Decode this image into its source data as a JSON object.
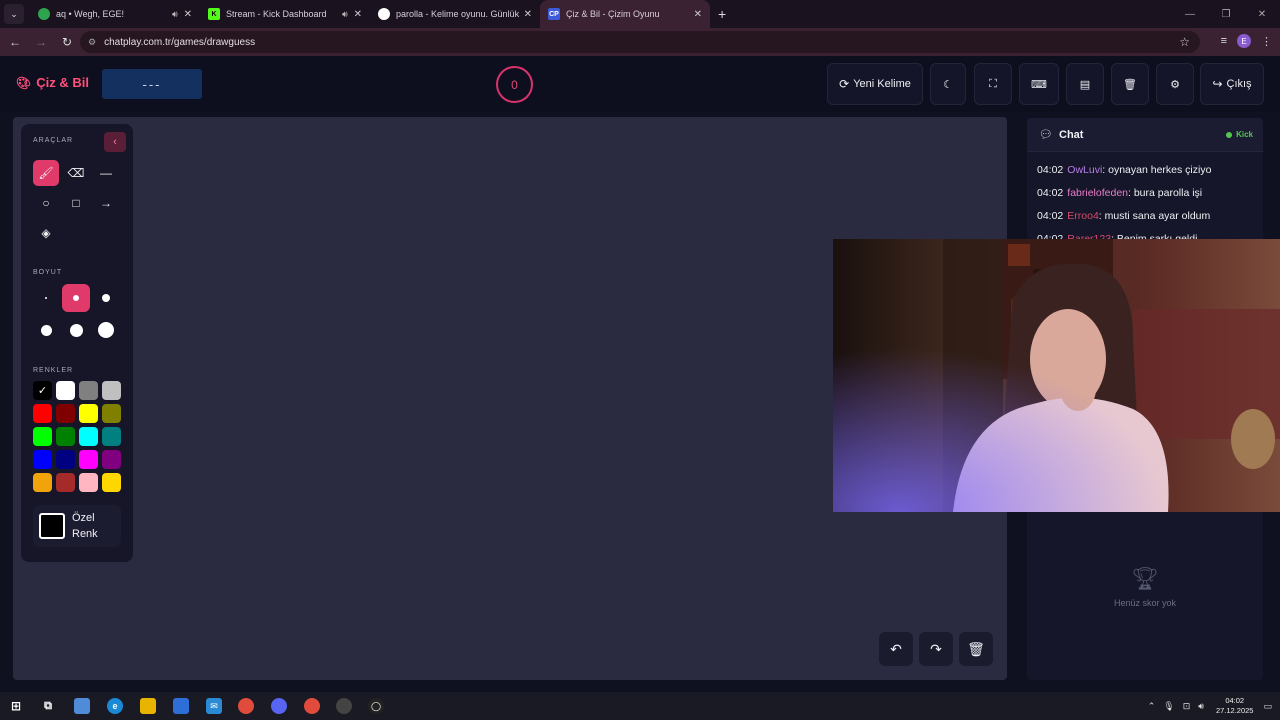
{
  "browser": {
    "tabs": [
      {
        "title": "aq • Wegh, EGE!",
        "favicon_color": "#2ea44f",
        "active": false,
        "sound": true
      },
      {
        "title": "Stream - Kick Dashboard",
        "favicon_color": "#53fc18",
        "active": false,
        "sound": true
      },
      {
        "title": "parolla - Kelime oyunu. Günlük",
        "favicon_color": "#ffffff",
        "active": false,
        "sound": false
      },
      {
        "title": "Çiz & Bil - Çizim Oyunu",
        "favicon_text": "CP",
        "favicon_color": "#3b5bdb",
        "active": true,
        "sound": false
      }
    ],
    "new_tab": "+",
    "url": "chatplay.com.tr/games/drawguess",
    "profile_initial": "E"
  },
  "app": {
    "logo": "Çiz & Bil",
    "word_hint": "---",
    "timer": "0",
    "buttons": {
      "new_word": "Yeni Kelime",
      "logout": "Çıkış"
    }
  },
  "toolbox": {
    "tools_label": "ARAÇLAR",
    "size_label": "BOYUT",
    "colors_label": "RENKLER",
    "custom_color_label": "Özel Renk",
    "active_tool": "brush",
    "sizes": [
      2,
      6,
      8,
      11,
      13,
      16
    ],
    "active_size_index": 1,
    "colors": [
      "#000000",
      "#ffffff",
      "#808080",
      "#c0c0c0",
      "#ff0000",
      "#800000",
      "#ffff00",
      "#808000",
      "#00ff00",
      "#008000",
      "#00ffff",
      "#008080",
      "#0000ff",
      "#000080",
      "#ff00ff",
      "#800080",
      "#f0a30a",
      "#a52a2a",
      "#ffb6c1",
      "#ffd700"
    ],
    "selected_color_index": 0
  },
  "chat": {
    "title": "Chat",
    "platform": "Kick",
    "messages": [
      {
        "time": "04:02",
        "user": "OwLuvi",
        "text": ": oynayan herkes çiziyo",
        "color": "#b87ee8"
      },
      {
        "time": "04:02",
        "user": "fabrielofeden",
        "text": ": bura parolla işi",
        "color": "#e87ec8"
      },
      {
        "time": "04:02",
        "user": "Erroo4",
        "text": ": musti sana ayar oldum",
        "color": "#d94a6a"
      },
      {
        "time": "04:02",
        "user": "Rarer123",
        "text": ": Benim şarkı geldi",
        "color": "#d94a6a"
      }
    ]
  },
  "scoreboard": {
    "empty_text": "Henüz skor yok"
  },
  "taskbar": {
    "time": "04:02",
    "date": "27.12.2025"
  }
}
